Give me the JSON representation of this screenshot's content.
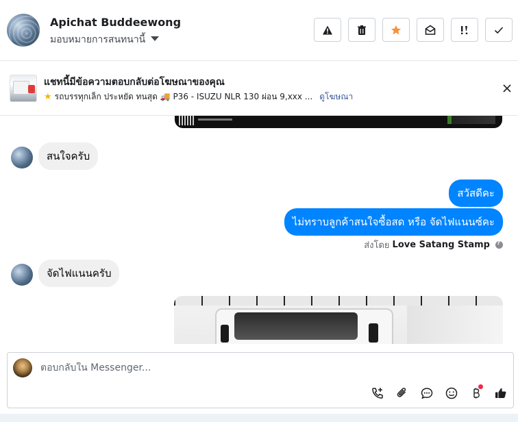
{
  "header": {
    "name": "Apichat Buddeewong",
    "assign_label": "มอบหมายการสนทนานี้",
    "actions": [
      {
        "icon": "warning-icon",
        "label": "Spam"
      },
      {
        "icon": "trash-icon",
        "label": "Delete"
      },
      {
        "icon": "star-icon",
        "label": "Star",
        "color": "#f7923b"
      },
      {
        "icon": "envelope-open-icon",
        "label": "Mark as unread"
      },
      {
        "icon": "follow-up-icon",
        "label": "Follow up"
      },
      {
        "icon": "check-icon",
        "label": "Done"
      }
    ]
  },
  "ad_banner": {
    "title": "แชทนี้มีข้อความตอบกลับต่อโฆษณาของคุณ",
    "description": "รถบรรทุกเล็ก ประหยัด ทนสุด 🚚 P36 - ISUZU NLR 130 ผ่อน 9,xxx ...",
    "link": "ดูโฆษณา"
  },
  "messages": [
    {
      "side": "in",
      "text": "สนใจครับ"
    },
    {
      "side": "out",
      "text": "สวัสดีคะ"
    },
    {
      "side": "out",
      "text": "ไม่ทราบลูกค้าสนใจซื้อสด หรือ จัดไฟแนนซ์คะ"
    },
    {
      "side": "in",
      "text": "จัดไฟแนนครับ"
    }
  ],
  "sent_by": {
    "prefix": "ส่งโดย",
    "sender": "Love Satang Stamp"
  },
  "composer": {
    "placeholder": "ตอบกลับใน Messenger...",
    "tools": [
      "call-add-icon",
      "attachment-icon",
      "saved-reply-icon",
      "emoji-icon",
      "baht-icon",
      "like-icon"
    ]
  },
  "colors": {
    "accent": "#0084ff",
    "star": "#f7923b",
    "link": "#385898",
    "notification_dot": "#f02849"
  }
}
